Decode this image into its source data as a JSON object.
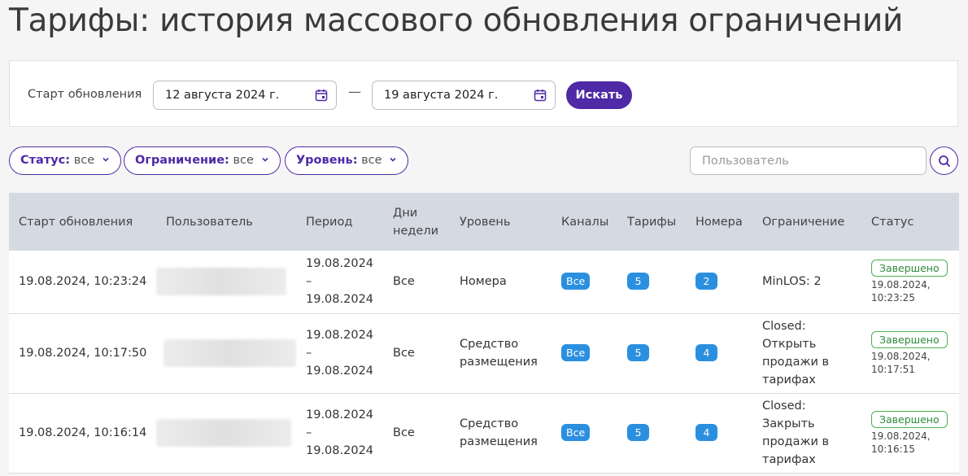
{
  "page": {
    "title": "Тарифы: история массового обновления ограничений"
  },
  "search_panel": {
    "label": "Старт обновления",
    "date_from": "12 августа 2024 г.",
    "separator": "—",
    "date_to": "19 августа 2024 г.",
    "search_button": "Искать"
  },
  "filters": [
    {
      "label": "Статус:",
      "value": "все"
    },
    {
      "label": "Ограничение:",
      "value": "все"
    },
    {
      "label": "Уровень:",
      "value": "все"
    }
  ],
  "user_search": {
    "placeholder": "Пользователь"
  },
  "table": {
    "headers": [
      "Старт обновления",
      "Пользователь",
      "Период",
      "Дни недели",
      "Уровень",
      "Каналы",
      "Тарифы",
      "Номера",
      "Ограничение",
      "Статус"
    ],
    "rows": [
      {
        "start": "19.08.2024, 10:23:24",
        "period": [
          "19.08.2024",
          "–",
          "19.08.2024"
        ],
        "days": "Все",
        "level": "Номера",
        "channels": "Все",
        "tariffs": "5",
        "rooms": "2",
        "restriction": "MinLOS: 2",
        "status": "Завершено",
        "status_date": "19.08.2024,",
        "status_time": "10:23:25"
      },
      {
        "start": "19.08.2024, 10:17:50",
        "period": [
          "19.08.2024",
          "–",
          "19.08.2024"
        ],
        "days": "Все",
        "level": "Средство размещения",
        "channels": "Все",
        "tariffs": "5",
        "rooms": "4",
        "restriction": "Closed: Открыть продажи в тарифах",
        "status": "Завершено",
        "status_date": "19.08.2024,",
        "status_time": "10:17:51"
      },
      {
        "start": "19.08.2024, 10:16:14",
        "period": [
          "19.08.2024",
          "–",
          "19.08.2024"
        ],
        "days": "Все",
        "level": "Средство размещения",
        "channels": "Все",
        "tariffs": "5",
        "rooms": "4",
        "restriction": "Closed: Закрыть продажи в тарифах",
        "status": "Завершено",
        "status_date": "19.08.2024,",
        "status_time": "10:16:15"
      }
    ]
  },
  "colors": {
    "accent": "#4e2aa6",
    "badge": "#2b8fe0",
    "status_ok": "#4caf50",
    "header_bg": "#d5d9e2"
  },
  "icons": {
    "calendar": "calendar-icon",
    "chevron": "chevron-down-icon",
    "search": "search-icon"
  }
}
